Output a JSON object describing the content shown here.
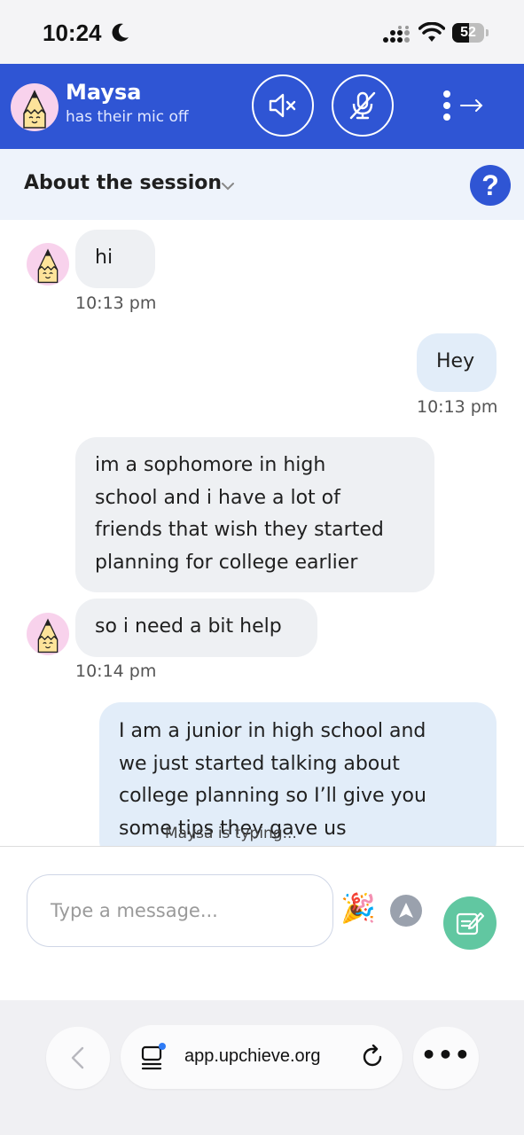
{
  "status_bar": {
    "time": "10:24",
    "battery": "52",
    "battery_level": 0.52
  },
  "header": {
    "name": "Maysa",
    "status": "has their mic off",
    "buttons": [
      "speaker-muted-icon",
      "mic-off-icon",
      "more-exit-icon"
    ]
  },
  "about": {
    "label": "About the session",
    "help": "?"
  },
  "messages": [
    {
      "dir": "in",
      "text": "hi",
      "time": "10:13 pm"
    },
    {
      "dir": "out",
      "text": "Hey",
      "time": "10:13 pm"
    },
    {
      "dir": "in",
      "lines": [
        "im a sophomore in high",
        "school and i have a lot of",
        "friends that wish they started",
        "planning for college earlier"
      ]
    },
    {
      "dir": "in",
      "text": "so i need a bit help",
      "time": "10:14 pm"
    },
    {
      "dir": "out",
      "lines": [
        "I am a junior in high school and",
        "we just started talking about",
        "college planning so I’ll give you",
        "some tips they gave us"
      ]
    }
  ],
  "typing_indicator": "Maysa is typing...",
  "composer": {
    "placeholder": "Type a message..."
  },
  "browser": {
    "url": "app.upchieve.org",
    "more": "•••"
  },
  "colors": {
    "brand": "#2f55d4",
    "send": "#61c7a1",
    "avatar_bg": "#f8d2ec"
  }
}
